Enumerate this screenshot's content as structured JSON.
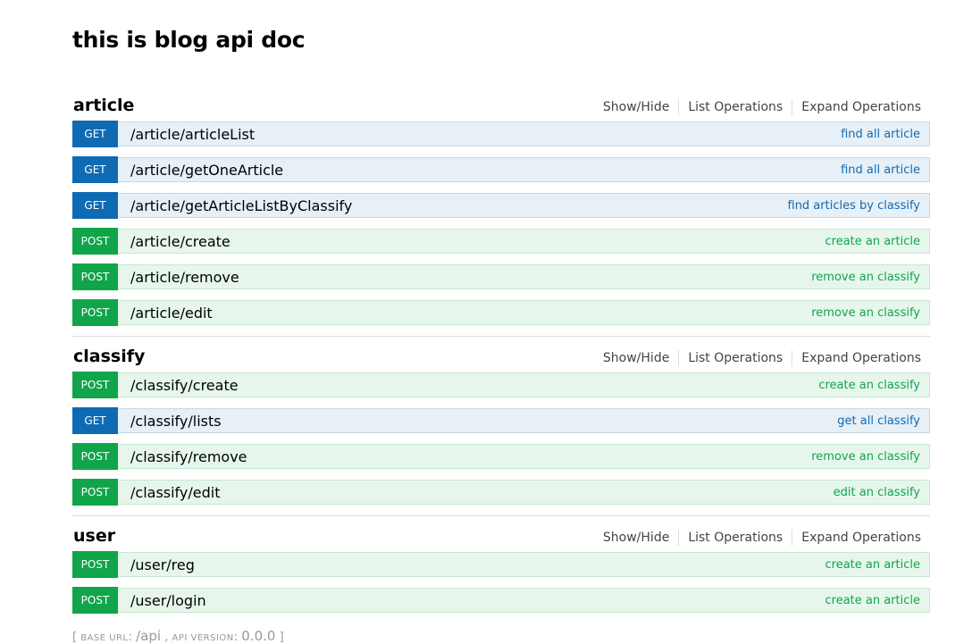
{
  "page": {
    "title": "this is blog api doc"
  },
  "resources": [
    {
      "name": "article",
      "actions": {
        "show_hide": "Show/Hide",
        "list_operations": "List Operations",
        "expand_operations": "Expand Operations"
      },
      "operations": [
        {
          "method": "GET",
          "path": "/article/articleList",
          "summary": "find all article"
        },
        {
          "method": "GET",
          "path": "/article/getOneArticle",
          "summary": "find all article"
        },
        {
          "method": "GET",
          "path": "/article/getArticleListByClassify",
          "summary": "find articles by classify"
        },
        {
          "method": "POST",
          "path": "/article/create",
          "summary": "create an article"
        },
        {
          "method": "POST",
          "path": "/article/remove",
          "summary": "remove an classify"
        },
        {
          "method": "POST",
          "path": "/article/edit",
          "summary": "remove an classify"
        }
      ]
    },
    {
      "name": "classify",
      "actions": {
        "show_hide": "Show/Hide",
        "list_operations": "List Operations",
        "expand_operations": "Expand Operations"
      },
      "operations": [
        {
          "method": "POST",
          "path": "/classify/create",
          "summary": "create an classify"
        },
        {
          "method": "GET",
          "path": "/classify/lists",
          "summary": "get all classify"
        },
        {
          "method": "POST",
          "path": "/classify/remove",
          "summary": "remove an classify"
        },
        {
          "method": "POST",
          "path": "/classify/edit",
          "summary": "edit an classify"
        }
      ]
    },
    {
      "name": "user",
      "actions": {
        "show_hide": "Show/Hide",
        "list_operations": "List Operations",
        "expand_operations": "Expand Operations"
      },
      "operations": [
        {
          "method": "POST",
          "path": "/user/reg",
          "summary": "create an article"
        },
        {
          "method": "POST",
          "path": "/user/login",
          "summary": "create an article"
        }
      ]
    }
  ],
  "footer": {
    "open_bracket": "[",
    "base_url_label": "base url",
    "separator": ":",
    "base_url": "/api",
    "comma": ",",
    "api_version_label": "api version",
    "api_version": "0.0.0",
    "close_bracket": "]"
  },
  "colors": {
    "get": "#0f6ab4",
    "post": "#10a54a",
    "get_bg": "#e7f0f7",
    "post_bg": "#e7f6ec"
  }
}
